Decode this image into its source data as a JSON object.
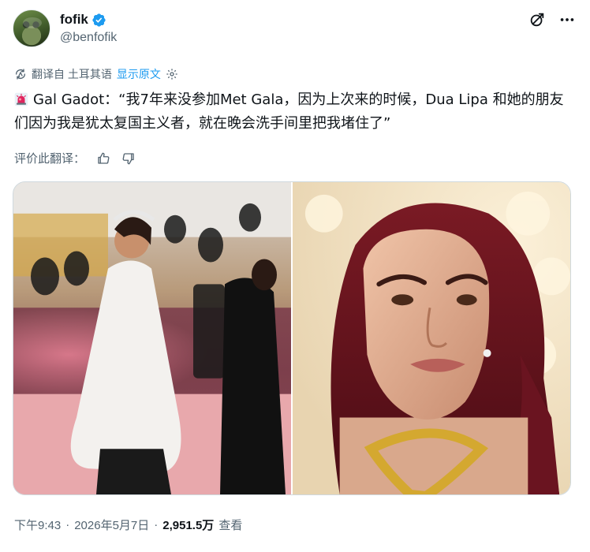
{
  "author": {
    "display_name": "fofik",
    "handle": "@benfofik"
  },
  "translation": {
    "translated_from": "翻译自 土耳其语",
    "show_original": "显示原文"
  },
  "tweet": {
    "text": "Gal Gadot：“我7年来没参加Met Gala，因为上次来的时候，Dua Lipa 和她的朋友们因为我是犹太复国主义者，就在晚会洗手间里把我堵住了”"
  },
  "rate": {
    "label": "评价此翻译："
  },
  "meta": {
    "time": "下午9:43",
    "date": "2026年5月7日",
    "views": "2,951.5万",
    "views_label": "查看"
  },
  "colors": {
    "accent": "#1d9bf0",
    "text_primary": "#0f1419",
    "text_secondary": "#536471"
  },
  "icons": [
    "verified-badge-icon",
    "grok-icon",
    "more-icon",
    "translate-icon",
    "gear-icon",
    "siren-icon",
    "thumbs-up-icon",
    "thumbs-down-icon"
  ]
}
